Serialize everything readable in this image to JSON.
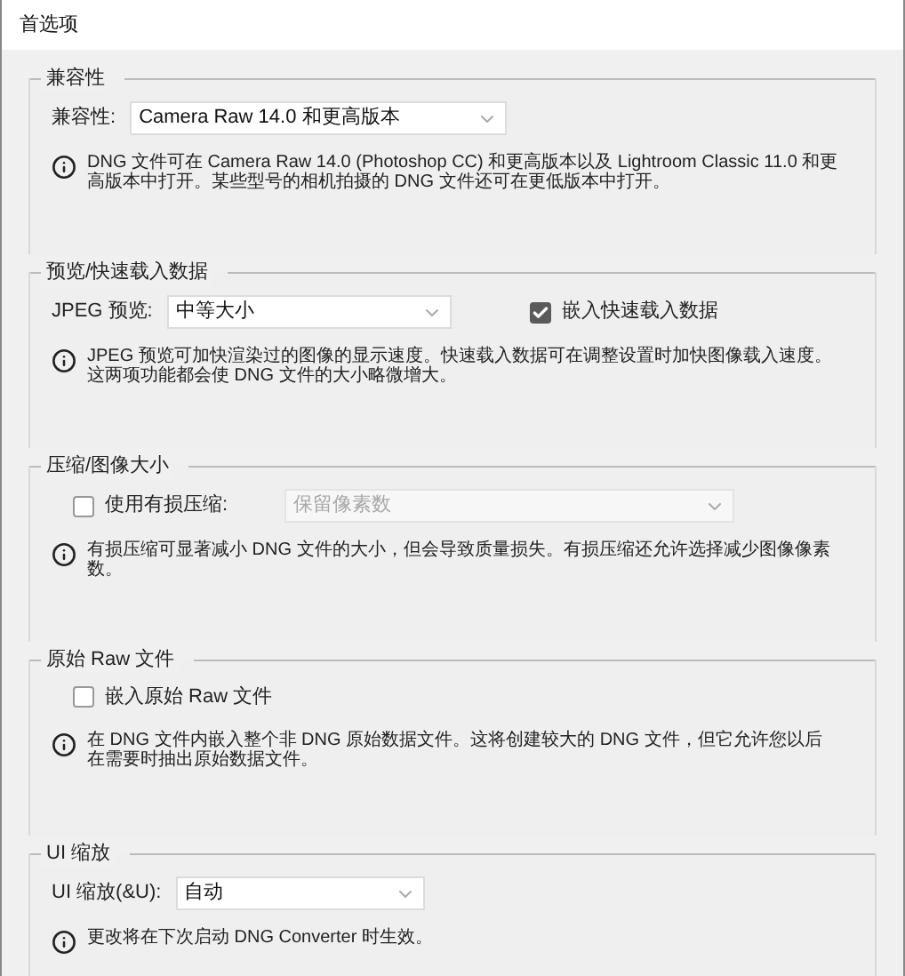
{
  "window": {
    "title": "首选项"
  },
  "sections": [
    {
      "title": "兼容性",
      "controls": [
        {
          "kind": "select",
          "label": "兼容性:",
          "value": "Camera Raw 14.0 和更高版本",
          "disabled": false
        }
      ],
      "info": "DNG 文件可在 Camera Raw 14.0 (Photoshop CC) 和更高版本以及 Lightroom Classic 11.0 和更高版本中打开。某些型号的相机拍摄的 DNG 文件还可在更低版本中打开。"
    },
    {
      "title": "预览/快速载入数据",
      "controls": [
        {
          "kind": "select",
          "label": "JPEG 预览:",
          "value": "中等大小",
          "disabled": false
        },
        {
          "kind": "checkbox",
          "label": "嵌入快速载入数据",
          "checked": true
        }
      ],
      "info": "JPEG 预览可加快渲染过的图像的显示速度。快速载入数据可在调整设置时加快图像载入速度。这两项功能都会使 DNG 文件的大小略微增大。"
    },
    {
      "title": "压缩/图像大小",
      "controls": [
        {
          "kind": "checkbox",
          "label": "使用有损压缩:",
          "checked": false
        },
        {
          "kind": "select",
          "value": "保留像素数",
          "disabled": true
        }
      ],
      "info": "有损压缩可显著减小 DNG 文件的大小，但会导致质量损失。有损压缩还允许选择减少图像像素数。"
    },
    {
      "title": "原始 Raw 文件",
      "controls": [
        {
          "kind": "checkbox",
          "label": "嵌入原始 Raw 文件",
          "checked": false
        }
      ],
      "info": "在 DNG 文件内嵌入整个非 DNG 原始数据文件。这将创建较大的 DNG 文件，但它允许您以后在需要时抽出原始数据文件。"
    },
    {
      "title": "UI 缩放",
      "controls": [
        {
          "kind": "select",
          "label": "UI 缩放(&U):",
          "value": "自动",
          "disabled": false
        }
      ],
      "info": "更改将在下次启动 DNG Converter 时生效。"
    }
  ]
}
